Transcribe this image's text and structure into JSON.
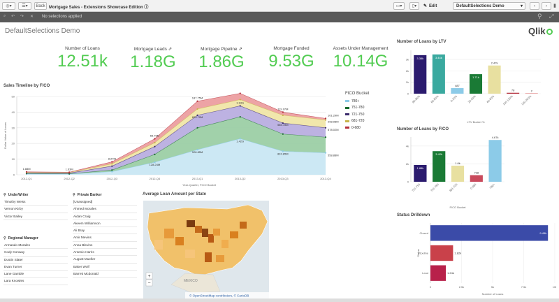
{
  "toolbar": {
    "back_label": "Back",
    "app_title": "Mortgage Sales - Extensions Showcase Edition",
    "edit_label": "Edit",
    "app_name": "DefaultSelections Demo"
  },
  "selections": {
    "status": "No selections applied"
  },
  "sheet": {
    "title": "DefaultSelections Demo",
    "logo": "Qlik"
  },
  "kpis": [
    {
      "label": "Number of Loans",
      "value": "12.51k"
    },
    {
      "label": "Mortgage Leads",
      "value": "1.18G"
    },
    {
      "label": "Mortgage Pipeline",
      "value": "1.86G"
    },
    {
      "label": "Mortgage Funded",
      "value": "9.53G"
    },
    {
      "label": "Assets Under Management",
      "value": "10.14G"
    }
  ],
  "timeline": {
    "title": "Sales Timeline by FICO",
    "ylabel": "Dollar Value of Loans",
    "xlabel": "Year-Quarter, FICO Bucket",
    "legend_title": "FICO Bucket",
    "legend": [
      "780+",
      "751-780",
      "721-750",
      "681-720",
      "0-680"
    ],
    "colors": [
      "#c9e7f3",
      "#9ccfa5",
      "#b9aee0",
      "#f0e6a8",
      "#ec9ea0"
    ],
    "markers": [
      "#8ccbe8",
      "#1a6b2e",
      "#3b2a6b",
      "#c8b34a",
      "#b32d3a"
    ],
    "categories": [
      "2012-Q1",
      "2012-Q2",
      "2012-Q3",
      "2012-Q4",
      "2013-Q1",
      "2013-Q2",
      "2013-Q3",
      "2013-Q4"
    ],
    "yticks": [
      "0",
      "10",
      "20",
      "30",
      "40",
      "50"
    ],
    "ymax": 50,
    "series": [
      {
        "name": "780+",
        "values": [
          0.5,
          0.4,
          2.0,
          8,
          16,
          23,
          15,
          14
        ]
      },
      {
        "name": "751-780",
        "values": [
          0.8,
          0.6,
          3.0,
          13,
          30,
          37,
          26,
          24
        ]
      },
      {
        "name": "721-750",
        "values": [
          1.2,
          1.1,
          5.5,
          18,
          38,
          44,
          33,
          30
        ]
      },
      {
        "name": "681-720",
        "values": [
          1.5,
          1.4,
          7.0,
          20.5,
          42,
          48,
          38,
          35
        ]
      },
      {
        "name": "0-680",
        "values": [
          1.88,
          1.63,
          8.27,
          23,
          47,
          52,
          40,
          36
        ]
      }
    ],
    "labels": [
      {
        "text": "1.88M",
        "x": 0,
        "y": "total"
      },
      {
        "text": "1.63M",
        "x": 1,
        "y": "total"
      },
      {
        "text": "8.27M",
        "x": 2,
        "y": "total"
      },
      {
        "text": "65.75M",
        "x": 3,
        "y": "total"
      },
      {
        "text": "128.24M",
        "x": 3,
        "y": "low"
      },
      {
        "text": "187.75M",
        "x": 4,
        "y": "total"
      },
      {
        "text": "823.79M",
        "x": 4,
        "y": "mid"
      },
      {
        "text": "928.85M",
        "x": 4,
        "y": "low"
      },
      {
        "text": "143.80M",
        "x": 5,
        "y": "top"
      },
      {
        "text": "1.94G",
        "x": 5,
        "y": "total"
      },
      {
        "text": "1.42G",
        "x": 5,
        "y": "low"
      },
      {
        "text": "119.97M",
        "x": 6,
        "y": "total"
      },
      {
        "text": "585.78M",
        "x": 6,
        "y": "mid"
      },
      {
        "text": "824.85M",
        "x": 6,
        "y": "low"
      },
      {
        "text": "101.29M",
        "x": 7,
        "y": "total"
      },
      {
        "text": "298.98M",
        "x": 7,
        "y": "s2"
      },
      {
        "text": "878.02M",
        "x": 7,
        "y": "mid"
      },
      {
        "text": "558.88M",
        "x": 7,
        "y": "low"
      }
    ]
  },
  "ltv": {
    "title": "Number of Loans by LTV",
    "xlabel": "LTV Bucket %",
    "categories": [
      "80-85%",
      "60-80%",
      "0-20%",
      "20-40%",
      "40-60%",
      "100-120%",
      "120-200%"
    ],
    "values": [
      3380,
      3440,
      487,
      1710,
      2470,
      78,
      2
    ],
    "labels": [
      "3.38k",
      "3.44k",
      "487",
      "1.71k",
      "2.47k",
      "78",
      "2"
    ],
    "colors": [
      "#2b1b6e",
      "#3aa99f",
      "#8ccbe8",
      "#1a7a35",
      "#e8e0a0",
      "#b32d3a",
      "#e07a7a"
    ],
    "yticks": [
      "0",
      "1k",
      "2k",
      "3k"
    ],
    "ymax": 3800
  },
  "fico": {
    "title": "Number of Loans by FICO",
    "xlabel": "FICO Bucket",
    "categories": [
      "721-750",
      "751-780",
      "681-720",
      "0-680",
      "780+"
    ],
    "values": [
      1880,
      3420,
      1800,
      738,
      4670
    ],
    "labels": [
      "1.88k",
      "3.42k",
      "1.8k",
      "738",
      "4.67k"
    ],
    "colors": [
      "#2b1b6e",
      "#1a7a35",
      "#e8e0a0",
      "#c94a5c",
      "#8ccbe8"
    ],
    "yticks": [
      "0",
      "2k",
      "4k"
    ],
    "ymax": 5000
  },
  "drilldown": {
    "title": "Status Drilldown",
    "ylabel": "Status",
    "xlabel": "Number of Loans",
    "categories": [
      "Closed",
      "Pipeline",
      "Lead"
    ],
    "values": [
      9450,
      1820,
      1240
    ],
    "labels": [
      "9.45k",
      "1.82k",
      "1.24k"
    ],
    "colors": [
      "#3b4ba8",
      "#c9414a",
      "#b8214a"
    ],
    "xticks": [
      "0",
      "2.5k",
      "5k",
      "7.5k",
      "10k"
    ],
    "xmax": 10000
  },
  "lists": {
    "underwriter": {
      "title": "UnderWriter",
      "items": [
        "Timothy Weiss",
        "Vernon Kirby",
        "Victor Bailey"
      ]
    },
    "regional": {
      "title": "Regional Manager",
      "items": [
        "Armando Morales",
        "Cody Conway",
        "Dustin Slater",
        "Evan Turner",
        "Lane Gamble",
        "Lara Knowles"
      ]
    },
    "banker": {
      "title": "Private Banker",
      "items": [
        "[Unassigned]",
        "Ahmed Morales",
        "Aidan Craig",
        "Akeem Williamson",
        "Ali Bray",
        "Amir Mevins",
        "Anna Blevins",
        "Arsenio Harris",
        "August Mueller",
        "Baker Wolf",
        "Barrett Mcdonald"
      ]
    }
  },
  "map": {
    "title": "Average Loan Amount per State",
    "country_label": "MEXICO",
    "attribution": "© OpenStreetMap contributors, © CartoDB"
  }
}
